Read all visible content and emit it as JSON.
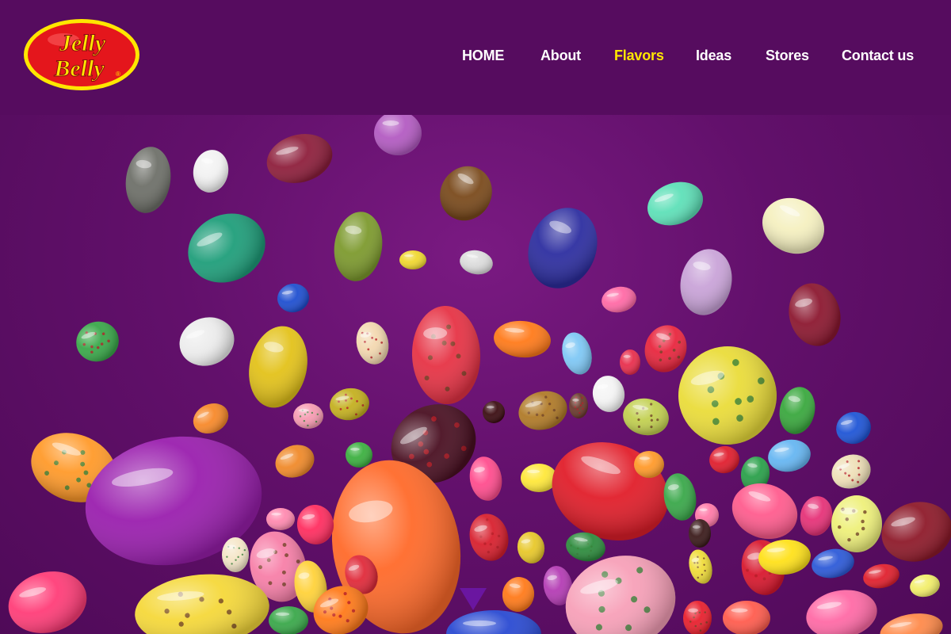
{
  "brand": {
    "logo_text_line1": "Jelly",
    "logo_text_line2": "Belly",
    "logo_registered": "®"
  },
  "nav": {
    "items": [
      {
        "label": "HOME",
        "name": "nav-home",
        "active": false
      },
      {
        "label": "About",
        "name": "nav-about",
        "active": false
      },
      {
        "label": "Flavors",
        "name": "nav-flavors",
        "active": true
      },
      {
        "label": "Ideas",
        "name": "nav-ideas",
        "active": false
      },
      {
        "label": "Stores",
        "name": "nav-stores",
        "active": false
      },
      {
        "label": "Contact us",
        "name": "nav-contact-us",
        "active": false
      }
    ]
  },
  "colors": {
    "header_bg": "#560c5f",
    "page_bg": "#62106b",
    "nav_text": "#ffffff",
    "nav_active": "#ffe600",
    "logo_red": "#e4161c",
    "logo_yellow": "#ffe600",
    "scroll_arrow": "#6a16a0"
  },
  "hero": {
    "image": "falling-jelly-beans",
    "scroll_control": "chevron-down-icon"
  }
}
